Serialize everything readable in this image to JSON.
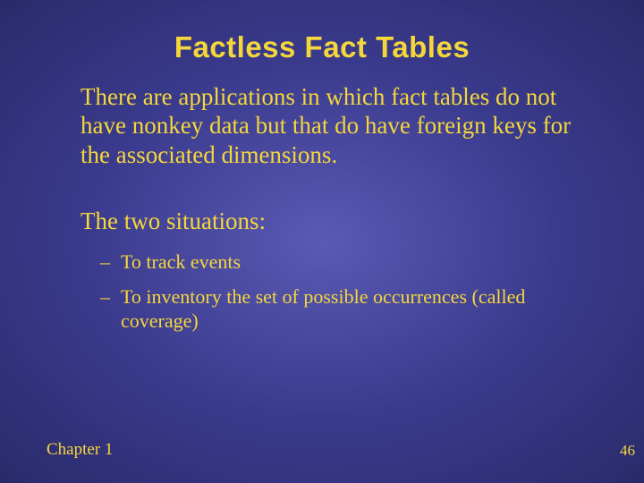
{
  "title": "Factless Fact Tables",
  "paragraph1": "There are applications in which fact tables do not have nonkey data but that do have foreign keys for the associated dimensions.",
  "subheading": "The two situations:",
  "bullets": [
    "To track events",
    "To inventory the set of possible occurrences (called coverage)"
  ],
  "footer": {
    "chapter": "Chapter 1",
    "page": "46"
  }
}
